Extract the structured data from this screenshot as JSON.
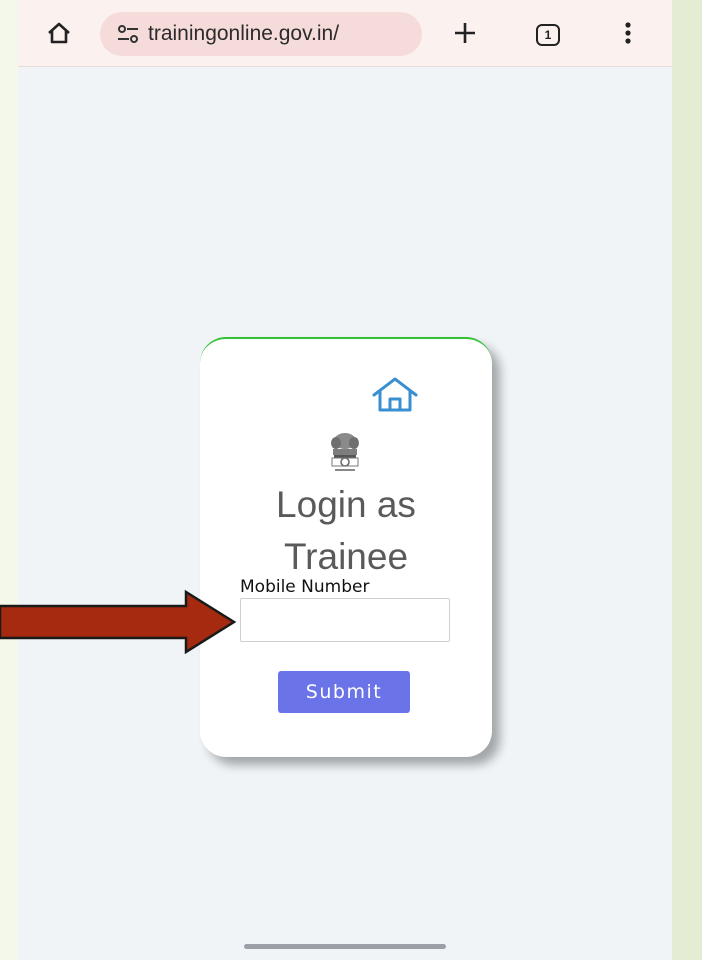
{
  "browser": {
    "url": "trainingonline.gov.in/",
    "tab_count": "1",
    "icons": {
      "home": "home-icon",
      "site_info": "tune-icon",
      "new_tab": "plus-icon",
      "tabs": "tab-switcher-icon",
      "menu": "kebab-menu-icon"
    }
  },
  "login": {
    "title_line1": "Login as",
    "title_line2": "Trainee",
    "mobile_label": "Mobile Number",
    "mobile_value": "",
    "submit_label": "Submit"
  },
  "colors": {
    "submit_button": "#6a73e8",
    "card_top_border": "#33c136",
    "home_icon": "#3a8fd0",
    "annotation_arrow": "#a52a0f"
  }
}
